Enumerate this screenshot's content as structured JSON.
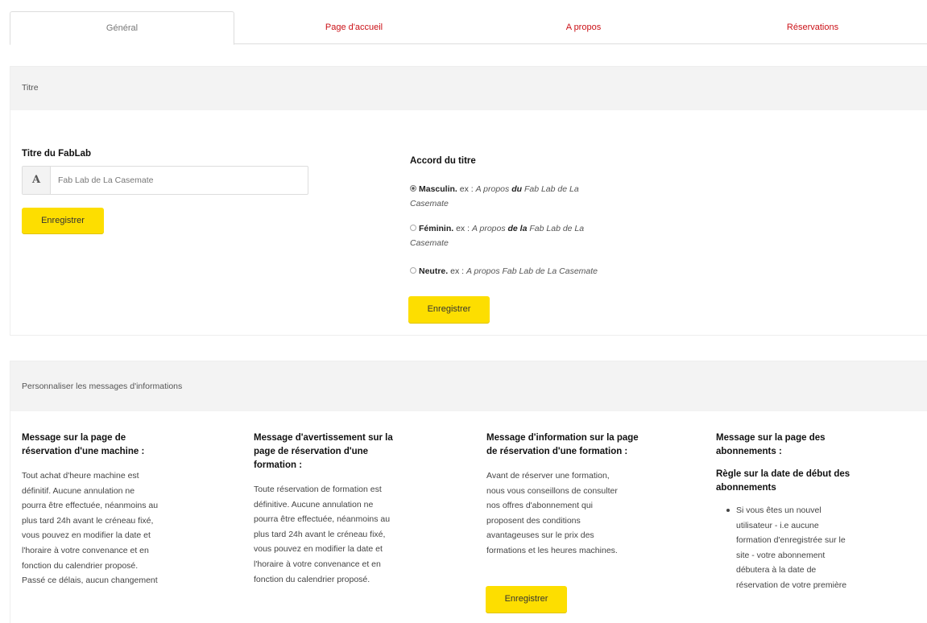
{
  "tabs": [
    "Général",
    "Page d'accueil",
    "A propos",
    "Réservations"
  ],
  "title_panel": {
    "heading": "Titre",
    "fablab_title_label": "Titre du FabLab",
    "input_addon": "A",
    "input_value": "Fab Lab de La Casemate",
    "save_label": "Enregistrer",
    "agreement_label": "Accord du titre",
    "options": [
      {
        "checked": true,
        "label": "Masculin.",
        "ex": "ex :",
        "prefix": "A propos",
        "article": "du",
        "rest": "Fab Lab de La",
        "cont": "Casemate"
      },
      {
        "checked": false,
        "label": "Féminin.",
        "ex": "ex :",
        "prefix": "A propos",
        "article": "de la",
        "rest": "Fab Lab de La",
        "cont": "Casemate"
      },
      {
        "checked": false,
        "label": "Neutre.",
        "ex": "ex :",
        "prefix": "A propos Fab Lab de La Casemate"
      }
    ],
    "save_label_2": "Enregistrer"
  },
  "messages_panel": {
    "heading": "Personnaliser les messages d'informations",
    "columns": [
      {
        "title": [
          "Message sur la page de",
          "réservation d'une machine :"
        ],
        "text": [
          "Tout achat d'heure machine est",
          "définitif. Aucune annulation ne",
          "pourra être effectuée, néanmoins au",
          "plus tard 24h avant le créneau fixé,",
          "vous pouvez en modifier la date et",
          "l'horaire à votre convenance et en",
          "fonction du calendrier proposé.",
          "Passé ce délais, aucun changement"
        ]
      },
      {
        "title": [
          "Message d'avertissement sur la",
          "page de réservation d'une",
          "formation :"
        ],
        "text": [
          "Toute réservation de formation est",
          "définitive. Aucune annulation ne",
          "pourra être effectuée, néanmoins au",
          "plus tard 24h avant le créneau fixé,",
          "vous pouvez en modifier la date et",
          "l'horaire à votre convenance et en",
          "fonction du calendrier proposé."
        ]
      },
      {
        "title": [
          "Message d'information sur la page",
          "de réservation d'une formation :"
        ],
        "text": [
          "Avant de réserver une formation,",
          "nous vous conseillons de consulter",
          "nos offres d'abonnement qui",
          "proposent des conditions",
          "avantageuses sur le prix des",
          "formations et les heures machines."
        ],
        "button": "Enregistrer"
      },
      {
        "title": [
          "Message sur la page des",
          "abonnements :"
        ],
        "subtitle": [
          "Règle sur la date de début des",
          "abonnements"
        ],
        "bullet": [
          "Si vous êtes un nouvel",
          "utilisateur - i.e aucune",
          "formation d'enregistrée sur le",
          "site - votre abonnement",
          "débutera à la date de",
          "réservation de votre première"
        ]
      }
    ]
  }
}
